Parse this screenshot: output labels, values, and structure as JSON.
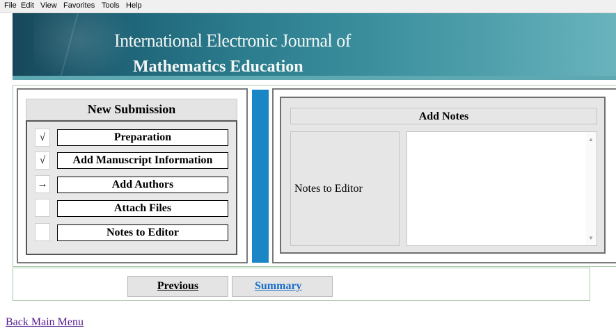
{
  "menu": [
    "File",
    "Edit",
    "View",
    "Favorites",
    "Tools",
    "Help"
  ],
  "banner": {
    "title_line1": "International Electronic Journal of",
    "title_line2": "Mathematics Education"
  },
  "submission": {
    "heading": "New Submission",
    "steps": [
      {
        "label": "Preparation",
        "mark": "√"
      },
      {
        "label": "Add Manuscript Information",
        "mark": "√"
      },
      {
        "label": "Add Authors",
        "mark": "→"
      },
      {
        "label": "Attach Files",
        "mark": ""
      },
      {
        "label": "Notes to Editor",
        "mark": ""
      }
    ]
  },
  "notes": {
    "heading": "Add Notes",
    "field_label": "Notes to Editor",
    "field_value": ""
  },
  "nav": {
    "previous": "Previous",
    "summary": "Summary"
  },
  "back_link": "Back Main Menu",
  "colors": {
    "accent_bar": "#1a86c5",
    "link": "#1a6ec9",
    "visited_link": "#551a8b"
  }
}
